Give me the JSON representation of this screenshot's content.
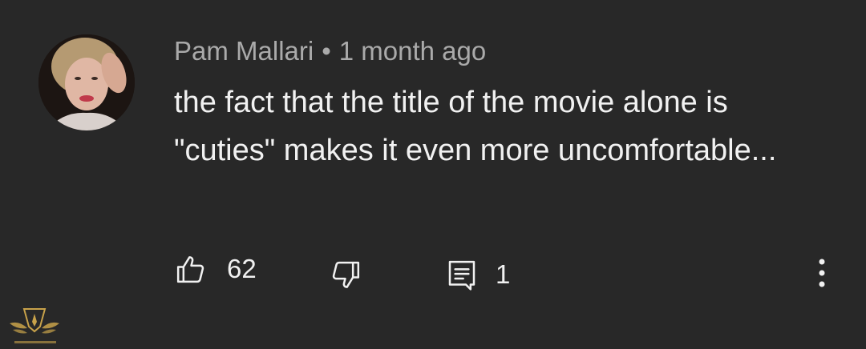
{
  "comment": {
    "author": "Pam Mallari",
    "separator": "•",
    "timestamp": "1 month ago",
    "text": "the fact that the title of the movie alone is \"cuties\" makes it even more uncomfortable..."
  },
  "actions": {
    "like_icon": "thumb-up-icon",
    "like_count": "62",
    "dislike_icon": "thumb-down-icon",
    "reply_icon": "comment-reply-icon",
    "reply_count": "1",
    "more_icon": "more-vertical-icon"
  },
  "colors": {
    "background": "#282828",
    "meta_text": "#aaaaaa",
    "body_text": "#f1f1f1",
    "watermark_gold": "#c8a24a"
  }
}
